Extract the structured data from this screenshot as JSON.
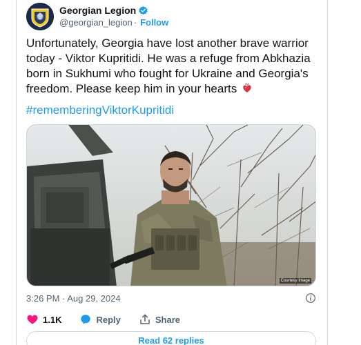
{
  "account": {
    "name": "Georgian Legion",
    "handle": "@georgian_legion",
    "separator": "·",
    "follow_label": "Follow"
  },
  "tweet": {
    "text": "Unfortunately, Georgia have lost another brave warrior today - Viktor Kupritidi. He was a refuge from Abkhazia born in Sukhumi who fought for Ukraine and Georgia's freedom. Please keep him in your hearts",
    "hashtag": "#rememberingViktorKupritidi",
    "timestamp": "3:26 PM · Aug 29, 2024"
  },
  "media": {
    "credit": "Courtesy Image"
  },
  "actions": {
    "likes_count": "1.1K",
    "reply_label": "Reply",
    "share_label": "Share",
    "read_replies_label": "Read 62 replies"
  },
  "colors": {
    "accent": "#1d9bf0",
    "like": "#f91880",
    "text_primary": "#0f1419",
    "text_secondary": "#536471",
    "border": "#cfd9de"
  },
  "icons": [
    "verified-icon",
    "heart-emoji-icon",
    "info-icon",
    "like-heart-icon",
    "reply-bubble-icon",
    "share-icon"
  ]
}
